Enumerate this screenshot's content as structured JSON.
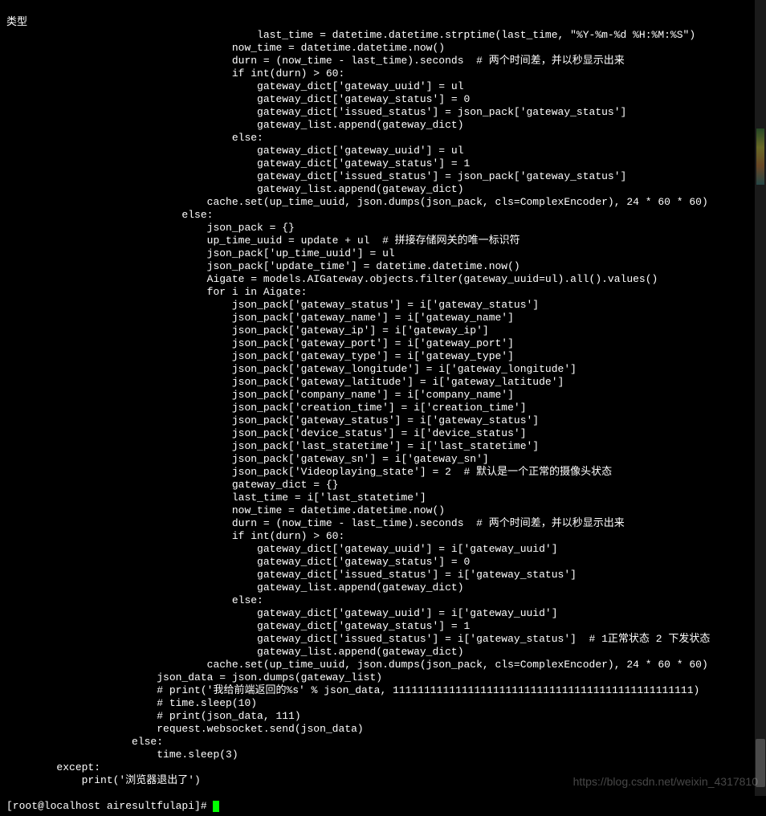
{
  "type_label": "类型",
  "code_lines": [
    "                                        last_time = datetime.datetime.strptime(last_time, \"%Y-%m-%d %H:%M:%S\")",
    "                                    now_time = datetime.datetime.now()",
    "                                    durn = (now_time - last_time).seconds  # 两个时间差，并以秒显示出来",
    "                                    if int(durn) > 60:",
    "                                        gateway_dict['gateway_uuid'] = ul",
    "                                        gateway_dict['gateway_status'] = 0",
    "                                        gateway_dict['issued_status'] = json_pack['gateway_status']",
    "                                        gateway_list.append(gateway_dict)",
    "                                    else:",
    "                                        gateway_dict['gateway_uuid'] = ul",
    "                                        gateway_dict['gateway_status'] = 1",
    "                                        gateway_dict['issued_status'] = json_pack['gateway_status']",
    "                                        gateway_list.append(gateway_dict)",
    "                                cache.set(up_time_uuid, json.dumps(json_pack, cls=ComplexEncoder), 24 * 60 * 60)",
    "                            else:",
    "                                json_pack = {}",
    "                                up_time_uuid = update + ul  # 拼接存储网关的唯一标识符",
    "                                json_pack['up_time_uuid'] = ul",
    "                                json_pack['update_time'] = datetime.datetime.now()",
    "                                Aigate = models.AIGateway.objects.filter(gateway_uuid=ul).all().values()",
    "                                for i in Aigate:",
    "                                    json_pack['gateway_status'] = i['gateway_status']",
    "                                    json_pack['gateway_name'] = i['gateway_name']",
    "                                    json_pack['gateway_ip'] = i['gateway_ip']",
    "                                    json_pack['gateway_port'] = i['gateway_port']",
    "                                    json_pack['gateway_type'] = i['gateway_type']",
    "                                    json_pack['gateway_longitude'] = i['gateway_longitude']",
    "                                    json_pack['gateway_latitude'] = i['gateway_latitude']",
    "                                    json_pack['company_name'] = i['company_name']",
    "                                    json_pack['creation_time'] = i['creation_time']",
    "                                    json_pack['gateway_status'] = i['gateway_status']",
    "                                    json_pack['device_status'] = i['device_status']",
    "                                    json_pack['last_statetime'] = i['last_statetime']",
    "                                    json_pack['gateway_sn'] = i['gateway_sn']",
    "                                    json_pack['Videoplaying_state'] = 2  # 默认是一个正常的摄像头状态",
    "                                    gateway_dict = {}",
    "                                    last_time = i['last_statetime']",
    "                                    now_time = datetime.datetime.now()",
    "                                    durn = (now_time - last_time).seconds  # 两个时间差，并以秒显示出来",
    "                                    if int(durn) > 60:",
    "                                        gateway_dict['gateway_uuid'] = i['gateway_uuid']",
    "                                        gateway_dict['gateway_status'] = 0",
    "                                        gateway_dict['issued_status'] = i['gateway_status']",
    "                                        gateway_list.append(gateway_dict)",
    "                                    else:",
    "                                        gateway_dict['gateway_uuid'] = i['gateway_uuid']",
    "                                        gateway_dict['gateway_status'] = 1",
    "                                        gateway_dict['issued_status'] = i['gateway_status']  # 1正常状态 2 下发状态",
    "                                        gateway_list.append(gateway_dict)",
    "                                cache.set(up_time_uuid, json.dumps(json_pack, cls=ComplexEncoder), 24 * 60 * 60)",
    "                        json_data = json.dumps(gateway_list)",
    "                        # print('我给前端返回的%s' % json_data, 111111111111111111111111111111111111111111111111)",
    "                        # time.sleep(10)",
    "                        # print(json_data, 111)",
    "                        request.websocket.send(json_data)",
    "                    else:",
    "                        time.sleep(3)",
    "",
    "        except:",
    "            print('浏览器退出了')"
  ],
  "prompt": "[root@localhost airesultfulapi]# ",
  "watermark": "https://blog.csdn.net/weixin_4317810"
}
